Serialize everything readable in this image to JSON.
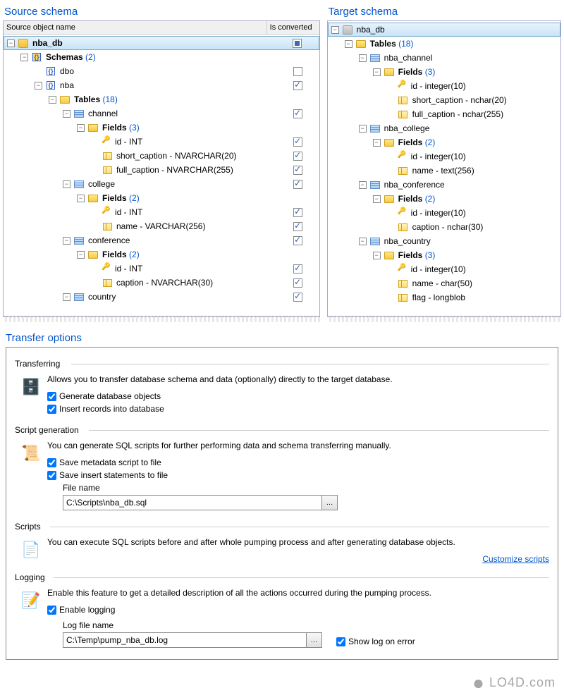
{
  "sourcePanel": {
    "title": "Source schema",
    "columns": {
      "name": "Source object name",
      "converted": "Is converted"
    }
  },
  "targetPanel": {
    "title": "Target schema"
  },
  "sourceTree": {
    "db": "nba_db",
    "schemasLabel": "Schemas",
    "schemasCount": "(2)",
    "schema_dbo": "dbo",
    "schema_nba": "nba",
    "tablesLabel": "Tables",
    "tablesCount": "(18)",
    "t_channel": "channel",
    "fieldsLabel": "Fields",
    "fields3": "(3)",
    "f_ch_id": "id - INT",
    "f_ch_short": "short_caption - NVARCHAR(20)",
    "f_ch_full": "full_caption - NVARCHAR(255)",
    "t_college": "college",
    "fields2": "(2)",
    "f_co_id": "id - INT",
    "f_co_name": "name - VARCHAR(256)",
    "t_conference": "conference",
    "f_cf_id": "id - INT",
    "f_cf_caption": "caption - NVARCHAR(30)",
    "t_country": "country"
  },
  "targetTree": {
    "db": "nba_db",
    "tablesLabel": "Tables",
    "tablesCount": "(18)",
    "t_channel": "nba_channel",
    "fieldsLabel": "Fields",
    "fields3": "(3)",
    "f_ch_id": "id - integer(10)",
    "f_ch_short": "short_caption - nchar(20)",
    "f_ch_full": "full_caption - nchar(255)",
    "t_college": "nba_college",
    "fields2": "(2)",
    "f_co_id": "id - integer(10)",
    "f_co_name": "name - text(256)",
    "t_conference": "nba_conference",
    "f_cf_id": "id - integer(10)",
    "f_cf_caption": "caption - nchar(30)",
    "t_country": "nba_country",
    "f_ct_id": "id - integer(10)",
    "f_ct_name": "name - char(50)",
    "f_ct_flag": "flag - longblob"
  },
  "transfer": {
    "title": "Transfer options",
    "transferring": {
      "header": "Transferring",
      "desc": "Allows you to transfer database schema and data (optionally) directly to the target database.",
      "cb1": "Generate database objects",
      "cb2": "Insert records into database"
    },
    "scriptGen": {
      "header": "Script generation",
      "desc": "You can generate SQL scripts for further performing data and schema transferring manually.",
      "cb1": "Save metadata script to file",
      "cb2": "Save insert statements to file",
      "fileLabel": "File name",
      "fileValue": "C:\\Scripts\\nba_db.sql"
    },
    "scripts": {
      "header": "Scripts",
      "desc": "You can execute SQL scripts before and after whole pumping process and after generating database objects.",
      "link": "Customize scripts"
    },
    "logging": {
      "header": "Logging",
      "desc": "Enable this feature to get a detailed description of all the actions occurred during the pumping process.",
      "cb1": "Enable logging",
      "fileLabel": "Log file name",
      "fileValue": "C:\\Temp\\pump_nba_db.log",
      "cb2": "Show log on error"
    }
  },
  "watermark": "LO4D.com"
}
